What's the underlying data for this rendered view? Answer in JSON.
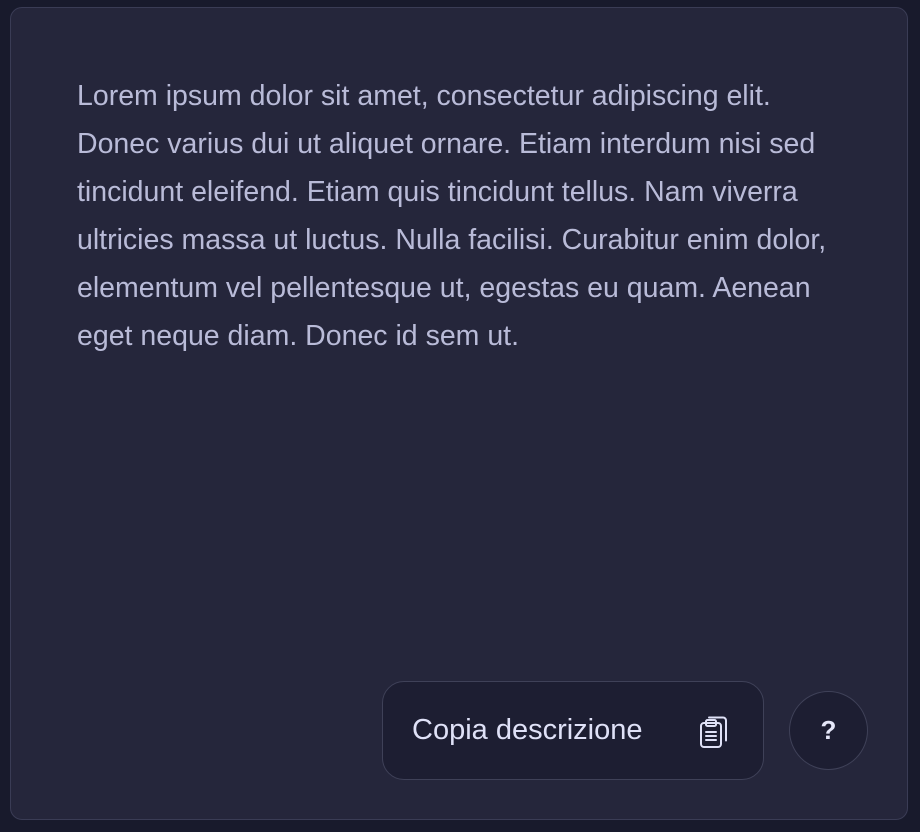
{
  "card": {
    "description": "Lorem ipsum dolor sit amet, consectetur adipiscing elit. Donec varius dui ut aliquet ornare. Etiam interdum nisi sed tincidunt eleifend. Etiam quis tincidunt tellus. Nam viverra ultricies massa ut luctus. Nulla facilisi. Curabitur enim dolor, elementum vel pellentesque ut, egestas eu quam. Aenean eget neque diam. Donec id sem ut."
  },
  "actions": {
    "copy_label": "Copia descrizione",
    "copy_icon": "clipboard-icon",
    "help_label": "?"
  },
  "colors": {
    "page_background": "#181a2c",
    "card_background": "#25263b",
    "text": "#b9bbd8",
    "button_background": "#1d1e32"
  }
}
